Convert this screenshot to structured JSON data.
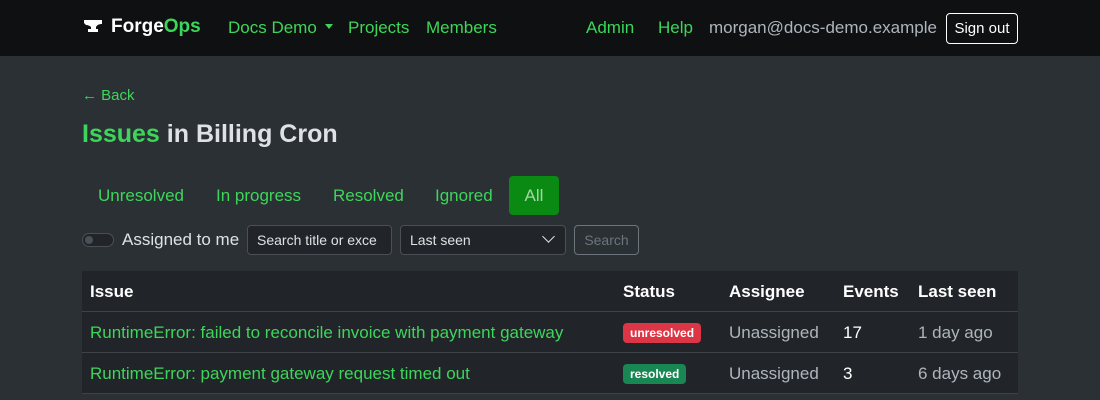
{
  "brand": {
    "name_prefix": "Forge",
    "name_suffix": "Ops",
    "icon": "anvil-icon"
  },
  "nav": {
    "project": "Docs Demo",
    "projects": "Projects",
    "members": "Members",
    "admin": "Admin",
    "help": "Help",
    "user_email": "morgan@docs-demo.example",
    "sign_out": "Sign out"
  },
  "page": {
    "back": "← Back",
    "title_accent": "Issues",
    "title_rest": "in Billing Cron"
  },
  "tabs": [
    {
      "label": "Unresolved",
      "active": false
    },
    {
      "label": "In progress",
      "active": false
    },
    {
      "label": "Resolved",
      "active": false
    },
    {
      "label": "Ignored",
      "active": false
    },
    {
      "label": "All",
      "active": true
    }
  ],
  "filters": {
    "assigned_label": "Assigned to me",
    "assigned_on": false,
    "search_placeholder": "Search title or exce",
    "sort_selected": "Last seen",
    "search_button": "Search"
  },
  "table": {
    "headers": [
      "Issue",
      "Status",
      "Assignee",
      "Events",
      "Last seen"
    ],
    "rows": [
      {
        "issue": "RuntimeError: failed to reconcile invoice with payment gateway",
        "status": "unresolved",
        "assignee": "Unassigned",
        "events": "17",
        "last_seen": "1 day ago"
      },
      {
        "issue": "RuntimeError: payment gateway request timed out",
        "status": "resolved",
        "assignee": "Unassigned",
        "events": "3",
        "last_seen": "6 days ago"
      }
    ]
  },
  "colors": {
    "accent": "#3dd65a",
    "active_tab": "#0a8a12",
    "unresolved": "#dc3545",
    "resolved": "#198754"
  }
}
